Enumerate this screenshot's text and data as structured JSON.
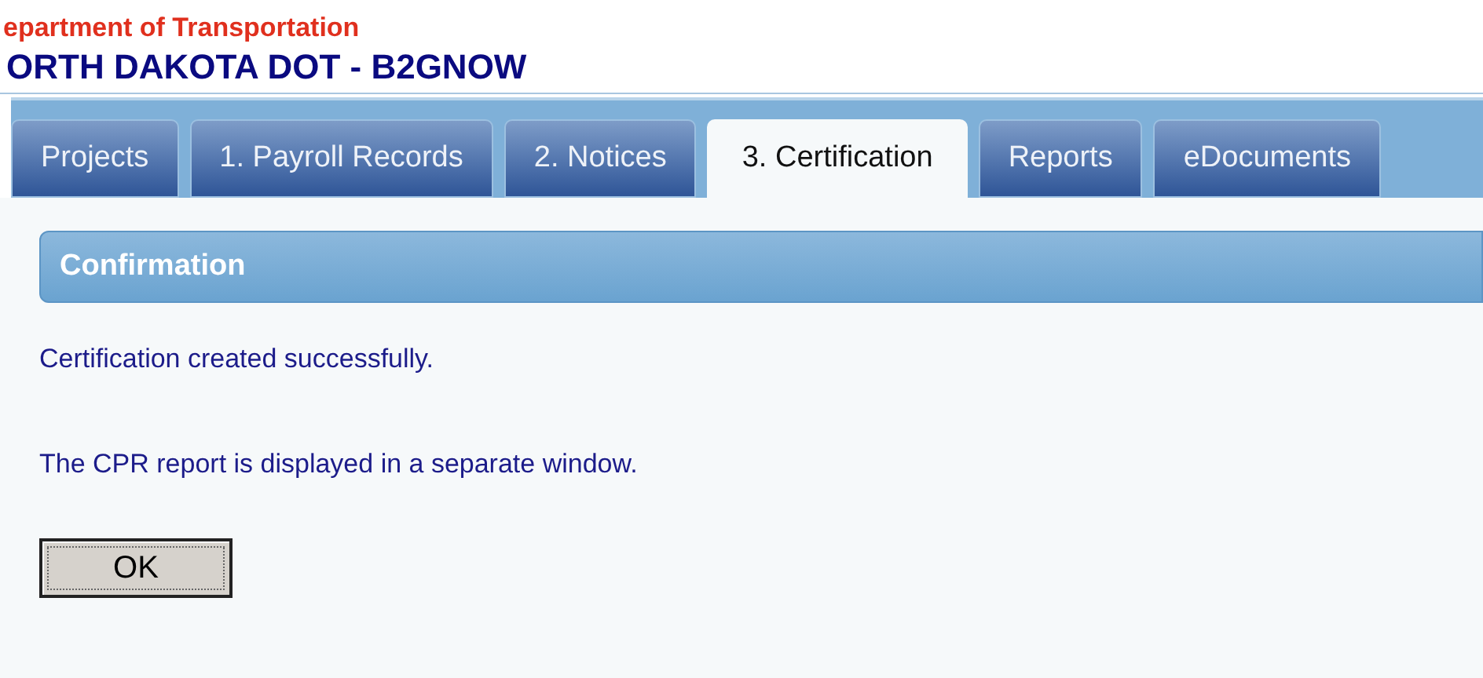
{
  "header": {
    "agency": "epartment of Transportation",
    "title": "ORTH DAKOTA DOT - B2GNOW"
  },
  "tabs": [
    {
      "label": "Projects",
      "selected": false
    },
    {
      "label": "1. Payroll Records",
      "selected": false
    },
    {
      "label": "2. Notices",
      "selected": false
    },
    {
      "label": "3. Certification",
      "selected": true
    },
    {
      "label": "Reports",
      "selected": false
    },
    {
      "label": "eDocuments",
      "selected": false
    }
  ],
  "panel": {
    "title": "Confirmation",
    "messages": [
      "Certification created successfully.",
      "The CPR report is displayed in a separate window."
    ],
    "button": "OK"
  }
}
